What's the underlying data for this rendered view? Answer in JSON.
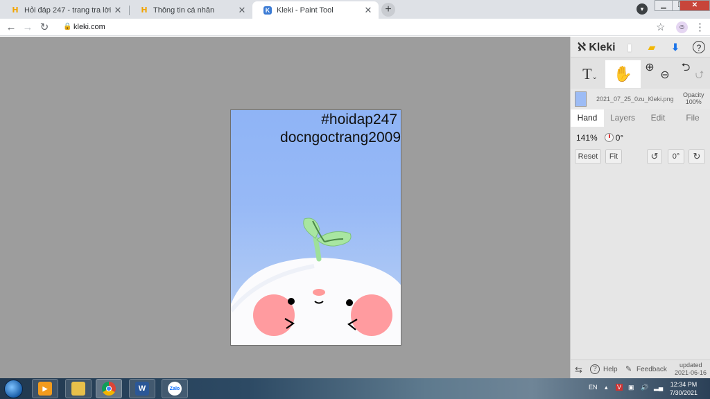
{
  "tabs": [
    {
      "title": "Hỏi đáp 247 - trang tra lời",
      "favicon": "H"
    },
    {
      "title": "Thông tin cá nhân",
      "favicon": "H"
    },
    {
      "title": "Kleki - Paint Tool",
      "favicon": "K",
      "active": true
    }
  ],
  "address": {
    "url": "kleki.com"
  },
  "canvas_text": {
    "line1": "#hoidap247",
    "line2": "docngoctrang2009"
  },
  "panel": {
    "logo": "Kleki",
    "filename": "2021_07_25_0zu_Kleki.png",
    "opacity_label": "Opacity",
    "opacity_value": "100%",
    "tabs": [
      "Hand",
      "Layers",
      "Edit",
      "File"
    ],
    "active_tab": "Hand",
    "zoom": "141%",
    "rotation": "0°",
    "buttons": {
      "reset": "Reset",
      "fit": "Fit",
      "angle": "0°"
    },
    "footer": {
      "help": "Help",
      "feedback": "Feedback",
      "updated_label": "updated",
      "updated_date": "2021-06-16"
    }
  },
  "taskbar": {
    "lang": "EN",
    "time": "12:34 PM",
    "date": "7/30/2021",
    "apps": [
      "media-player",
      "file-explorer",
      "chrome",
      "word",
      "zalo"
    ],
    "zalo_label": "Zalo",
    "word_label": "W"
  },
  "colors": {
    "canvas_top": "#8fb4f6",
    "workspace": "#9d9d9d",
    "panel": "#e6e6e6",
    "accent_download": "#1a73e8"
  }
}
